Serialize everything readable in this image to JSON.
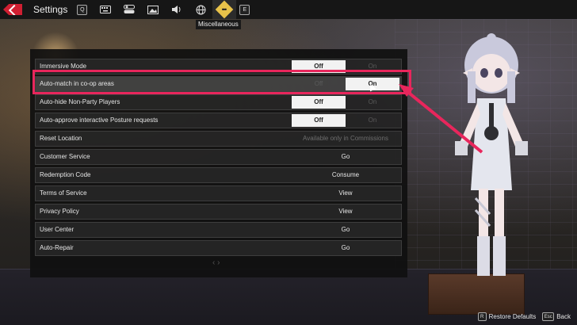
{
  "topbar": {
    "title": "Settings",
    "key_prev": "Q",
    "key_next": "E",
    "tabs": [
      {
        "icon": "keyboard-icon"
      },
      {
        "icon": "controls-toggle-icon"
      },
      {
        "icon": "image-icon"
      },
      {
        "icon": "speaker-icon"
      },
      {
        "icon": "globe-icon"
      },
      {
        "icon": "miscellaneous-icon",
        "active": true
      }
    ],
    "tooltip": "Miscellaneous"
  },
  "settings": {
    "rows": [
      {
        "label": "Immersive Mode",
        "type": "toggle",
        "off": "Off",
        "on": "On",
        "selected": "Off"
      },
      {
        "label": "Auto-match in co-op areas",
        "type": "toggle",
        "off": "Off",
        "on": "On",
        "selected": "On"
      },
      {
        "label": "Auto-hide Non-Party Players",
        "type": "toggle",
        "off": "Off",
        "on": "On",
        "selected": "Off"
      },
      {
        "label": "Auto-approve interactive Posture requests",
        "type": "toggle",
        "off": "Off",
        "on": "On",
        "selected": "Off"
      },
      {
        "label": "Reset Location",
        "type": "button",
        "value": "Available only in Commissions",
        "disabled": true
      },
      {
        "label": "Customer Service",
        "type": "button",
        "value": "Go"
      },
      {
        "label": "Redemption Code",
        "type": "button",
        "value": "Consume"
      },
      {
        "label": "Terms of Service",
        "type": "button",
        "value": "View"
      },
      {
        "label": "Privacy Policy",
        "type": "button",
        "value": "View"
      },
      {
        "label": "User Center",
        "type": "button",
        "value": "Go"
      },
      {
        "label": "Auto-Repair",
        "type": "button",
        "value": "Go"
      }
    ]
  },
  "footer": {
    "restore_key": "R",
    "restore_label": "Restore Defaults",
    "back_key": "Esc",
    "back_label": "Back"
  },
  "colors": {
    "accent_red": "#d01f32",
    "highlight_pink": "#e8265c",
    "tab_active": "#e8c24a"
  }
}
